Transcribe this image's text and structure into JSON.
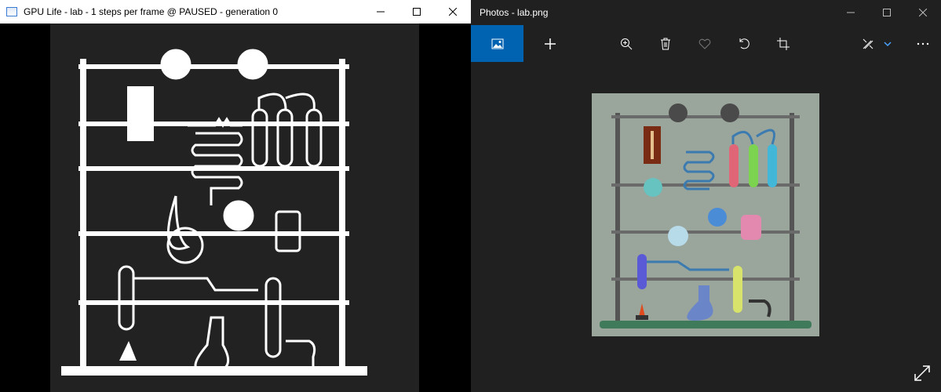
{
  "gpu_window": {
    "title": "GPU Life - lab - 1 steps per frame @ PAUSED - generation 0",
    "controls": [
      "minimize-icon",
      "maximize-icon",
      "close-icon"
    ]
  },
  "photos_window": {
    "title": "Photos - lab.png",
    "controls": [
      "minimize-icon",
      "maximize-icon",
      "close-icon"
    ],
    "toolbar": [
      "image-icon",
      "add-icon",
      "zoom-in-icon",
      "delete-icon",
      "favorite-icon",
      "rotate-icon",
      "crop-icon",
      "edit-draw-icon",
      "chevron-down-icon",
      "more-icon"
    ],
    "footer": [
      "expand-icon"
    ]
  },
  "colors": {
    "accent": "#0063b1",
    "photos_bg": "#202020",
    "lab_bg": "#9aa59c",
    "cell_on": "#ffffff",
    "cell_off": "#222222"
  }
}
